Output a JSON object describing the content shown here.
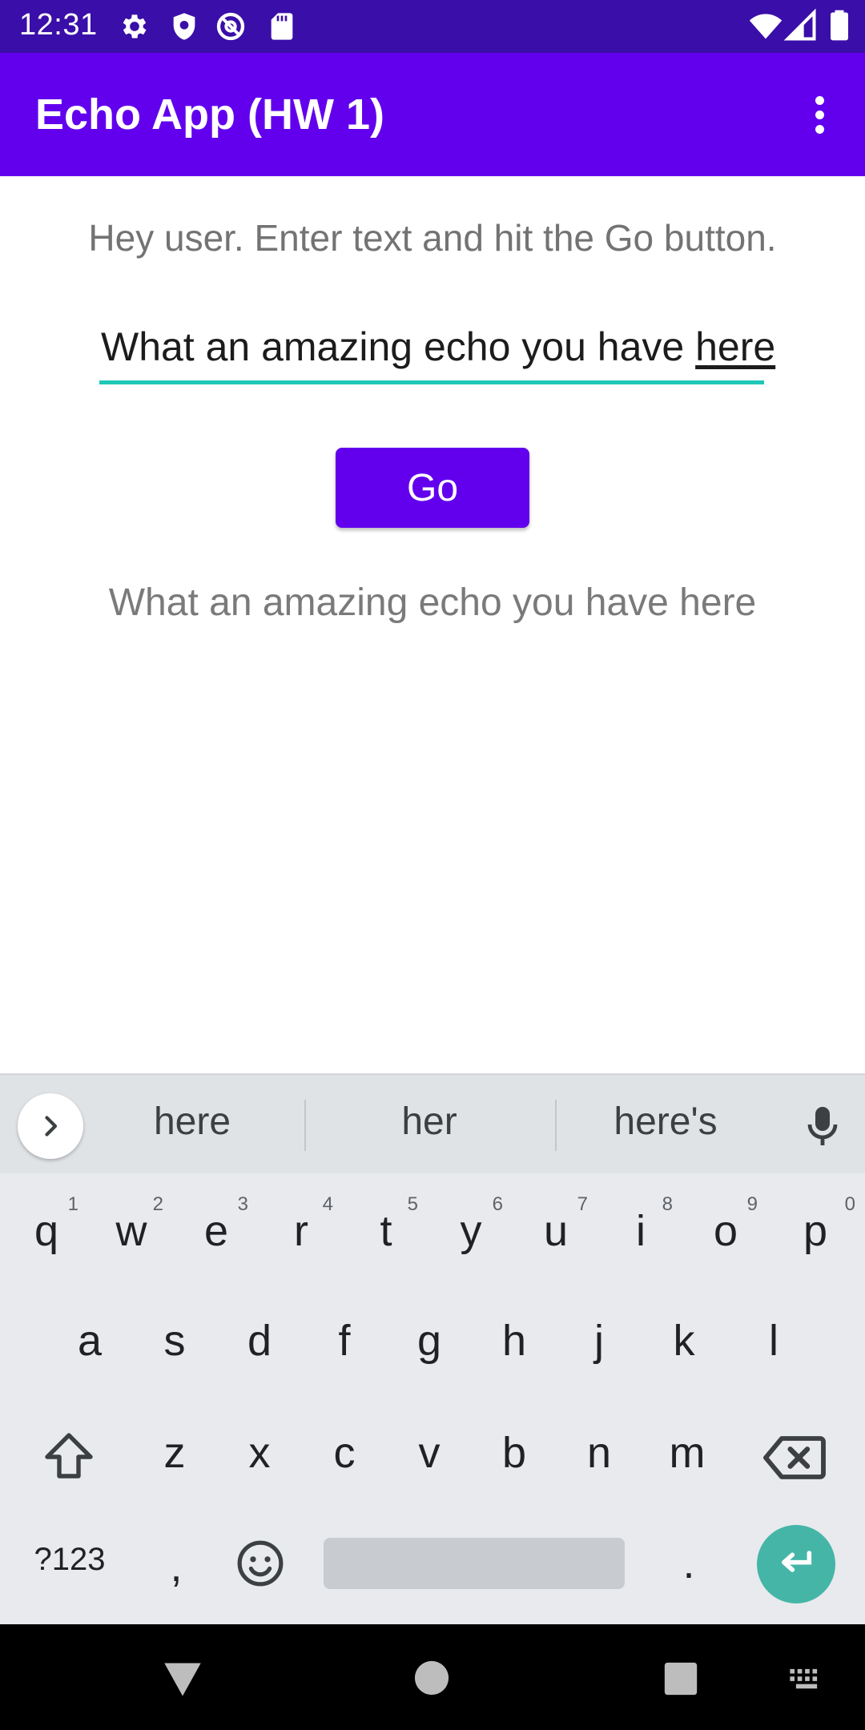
{
  "status_bar": {
    "time": "12:31",
    "icons": [
      "settings-icon",
      "shield-icon",
      "at-sign-icon",
      "sd-card-icon",
      "wifi-icon",
      "signal-icon",
      "battery-icon"
    ]
  },
  "app_bar": {
    "title": "Echo App (HW 1)",
    "menu_icon": "more-vert-icon"
  },
  "content": {
    "prompt": "Hey user. Enter text and hit the Go button.",
    "input": {
      "value_prefix": "What an amazing echo you have ",
      "value_composing": "here"
    },
    "go_button": "Go",
    "echo_output": "What an amazing echo you have here"
  },
  "keyboard": {
    "suggestions": [
      "here",
      "her",
      "here's"
    ],
    "row1": [
      {
        "key": "q",
        "hint": "1"
      },
      {
        "key": "w",
        "hint": "2"
      },
      {
        "key": "e",
        "hint": "3"
      },
      {
        "key": "r",
        "hint": "4"
      },
      {
        "key": "t",
        "hint": "5"
      },
      {
        "key": "y",
        "hint": "6"
      },
      {
        "key": "u",
        "hint": "7"
      },
      {
        "key": "i",
        "hint": "8"
      },
      {
        "key": "o",
        "hint": "9"
      },
      {
        "key": "p",
        "hint": "0"
      }
    ],
    "row2": [
      "a",
      "s",
      "d",
      "f",
      "g",
      "h",
      "j",
      "k",
      "l"
    ],
    "row3": [
      "z",
      "x",
      "c",
      "v",
      "b",
      "n",
      "m"
    ],
    "symbols_key": "?123",
    "comma_key": ",",
    "period_key": "."
  },
  "colors": {
    "status_bar": "#3a0ea8",
    "primary": "#6200ee",
    "accent": "#1fc7b6",
    "enter_key": "#45b5a8"
  }
}
